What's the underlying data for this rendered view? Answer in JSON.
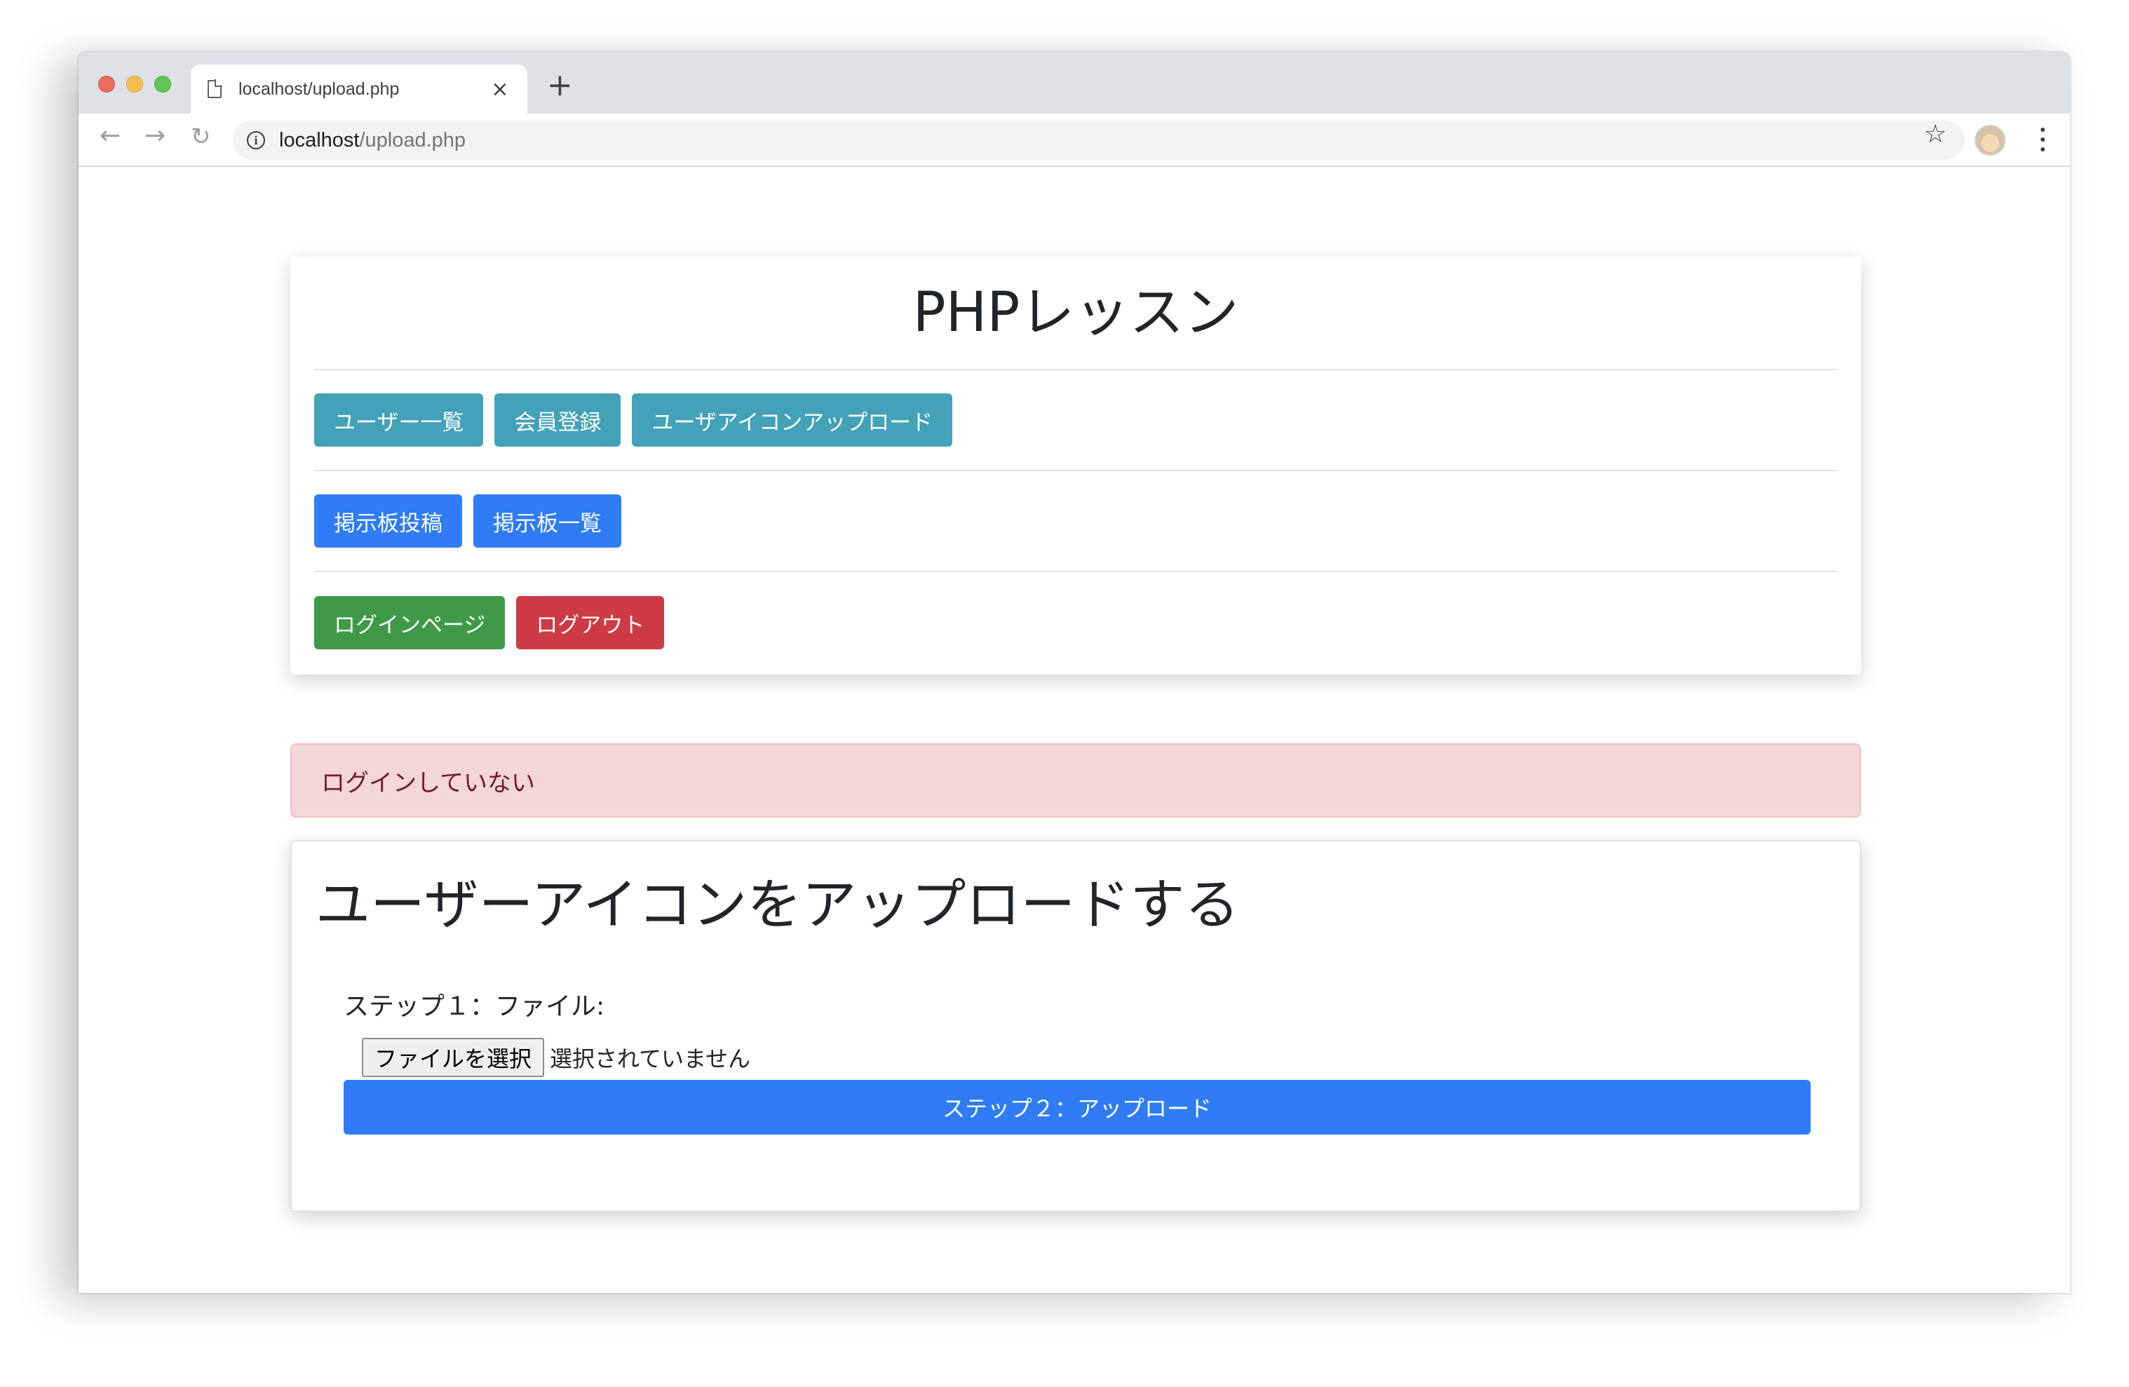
{
  "browser": {
    "tab_title": "localhost/upload.php",
    "tab_close": "×",
    "new_tab": "+",
    "url_host": "localhost",
    "url_path": "/upload.php",
    "back_icon": "←",
    "forward_icon": "→",
    "reload_icon": "↻",
    "info_icon": "i",
    "star_icon": "☆"
  },
  "header": {
    "title": "PHPレッスン"
  },
  "nav": {
    "row1": [
      "ユーザー一覧",
      "会員登録",
      "ユーザアイコンアップロード"
    ],
    "row2": [
      "掲示板投稿",
      "掲示板一覧"
    ],
    "row3": [
      "ログインページ",
      "ログアウト"
    ]
  },
  "alert": {
    "message": "ログインしていない"
  },
  "upload": {
    "title": "ユーザーアイコンをアップロードする",
    "step1_label": "ステップ１：ファイル:",
    "file_button": "ファイルを選択",
    "file_status": "選択されていません",
    "submit_label": "ステップ２：アップロード"
  },
  "colors": {
    "info": "#43a2b8",
    "primary": "#2f7cf6",
    "success": "#3f9a48",
    "danger": "#cf3b44",
    "alert_bg": "#f4d6d9"
  }
}
